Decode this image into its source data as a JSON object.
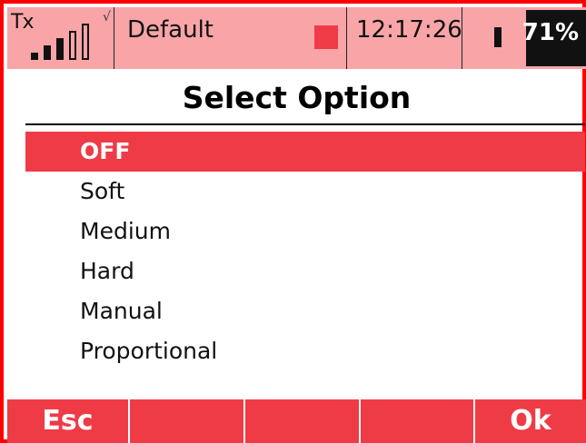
{
  "status_bar": {
    "tx_label": "Tx",
    "signal_bars_filled": 3,
    "signal_bars_total": 5,
    "signal_check": "√",
    "model_name": "Default",
    "time": "12:17:26",
    "battery_percent": "71%",
    "battery_level": 0.71
  },
  "dialog": {
    "title": "Select Option",
    "options": [
      {
        "label": "OFF",
        "selected": true
      },
      {
        "label": "Soft",
        "selected": false
      },
      {
        "label": "Medium",
        "selected": false
      },
      {
        "label": "Hard",
        "selected": false
      },
      {
        "label": "Manual",
        "selected": false
      },
      {
        "label": "Proportional",
        "selected": false
      }
    ]
  },
  "softkeys": {
    "left": "Esc",
    "key2": "",
    "key3": "",
    "key4": "",
    "right": "Ok"
  },
  "colors": {
    "accent": "#ef3b46",
    "status_bg": "#f9a5a8",
    "frame": "#ff0000"
  }
}
